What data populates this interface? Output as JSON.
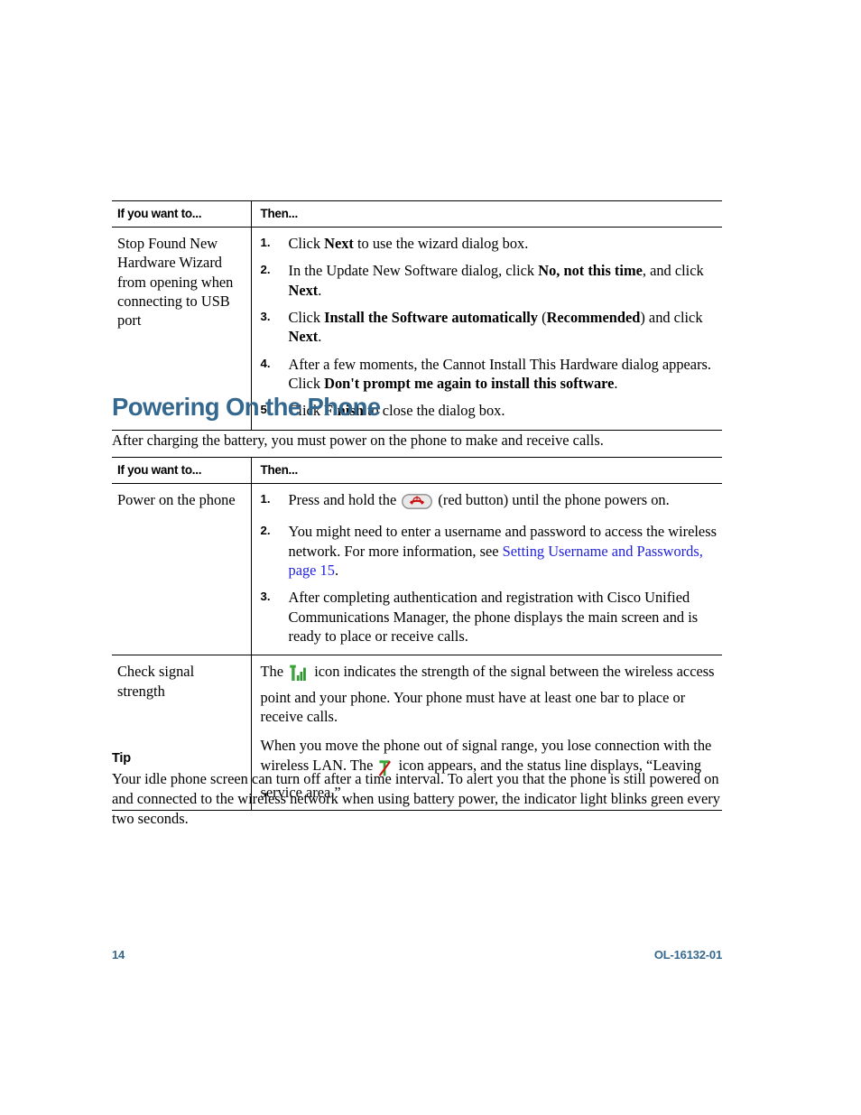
{
  "colors": {
    "heading": "#35688e",
    "link": "#2222dd",
    "footer": "#35688e",
    "signal_green": "#3aa63a",
    "button_red": "#cc1111"
  },
  "table1": {
    "headers": {
      "col1": "If you want to...",
      "col2": "Then..."
    },
    "rows": [
      {
        "if_you_want_to": "Stop Found New Hardware Wizard from opening when connecting to USB port",
        "steps": [
          {
            "num": "1.",
            "parts": [
              {
                "t": "Click ",
                "b": false
              },
              {
                "t": "Next",
                "b": true
              },
              {
                "t": " to use the wizard dialog box.",
                "b": false
              }
            ]
          },
          {
            "num": "2.",
            "parts": [
              {
                "t": "In the Update New Software dialog, click ",
                "b": false
              },
              {
                "t": "No, not this time",
                "b": true
              },
              {
                "t": ", and click ",
                "b": false
              },
              {
                "t": "Next",
                "b": true
              },
              {
                "t": ".",
                "b": false
              }
            ]
          },
          {
            "num": "3.",
            "parts": [
              {
                "t": "Click ",
                "b": false
              },
              {
                "t": "Install the Software automatically",
                "b": true
              },
              {
                "t": " (",
                "b": false
              },
              {
                "t": "Recommended",
                "b": true
              },
              {
                "t": ") and click ",
                "b": false
              },
              {
                "t": "Next",
                "b": true
              },
              {
                "t": ".",
                "b": false
              }
            ]
          },
          {
            "num": "4.",
            "parts": [
              {
                "t": "After a few moments, the Cannot Install This Hardware dialog appears. Click ",
                "b": false
              },
              {
                "t": "Don't prompt me again to install this software",
                "b": true
              },
              {
                "t": ".",
                "b": false
              }
            ]
          },
          {
            "num": "5.",
            "parts": [
              {
                "t": "Click ",
                "b": false
              },
              {
                "t": "Finish",
                "b": true
              },
              {
                "t": " to close the dialog box.",
                "b": false
              }
            ]
          }
        ]
      }
    ]
  },
  "section": {
    "title": "Powering On the Phone",
    "intro": "After charging the battery, you must power on the phone to make and receive calls."
  },
  "table2": {
    "headers": {
      "col1": "If you want to...",
      "col2": "Then..."
    },
    "row_power": {
      "if_you_want_to": "Power on the phone",
      "step1": {
        "num": "1.",
        "before_icon": "Press and hold the ",
        "icon": "red-power-button-icon",
        "after_icon": " (red button) until the phone powers on."
      },
      "step2": {
        "num": "2.",
        "text_before_link": "You might need to enter a username and password to access the wireless network. For more information, see ",
        "link_text": "Setting Username and Passwords, page 15",
        "text_after_link": "."
      },
      "step3": {
        "num": "3.",
        "text": "After completing authentication and registration with Cisco Unified Communications Manager, the phone displays the main screen and is ready to place or receive calls."
      }
    },
    "row_signal": {
      "if_you_want_to": "Check signal strength",
      "para1": {
        "before_icon": "The ",
        "icon": "signal-strength-icon",
        "after_icon": " icon indicates the strength of the signal between the wireless access point and your phone. Your phone must have at least one bar to place or receive calls."
      },
      "para2": {
        "before_icon": "When you move the phone out of signal range, you lose connection with the wireless LAN. The ",
        "icon": "no-signal-icon",
        "after_icon": " icon appears, and the status line displays, “Leaving service area.”"
      }
    }
  },
  "tip": {
    "title": "Tip",
    "body": "Your idle phone screen can turn off after a time interval. To alert you that the phone is still powered on and connected to the wireless network when using battery power, the indicator light blinks green every two seconds."
  },
  "footer": {
    "page_number": "14",
    "doc_id": "OL-16132-01"
  }
}
